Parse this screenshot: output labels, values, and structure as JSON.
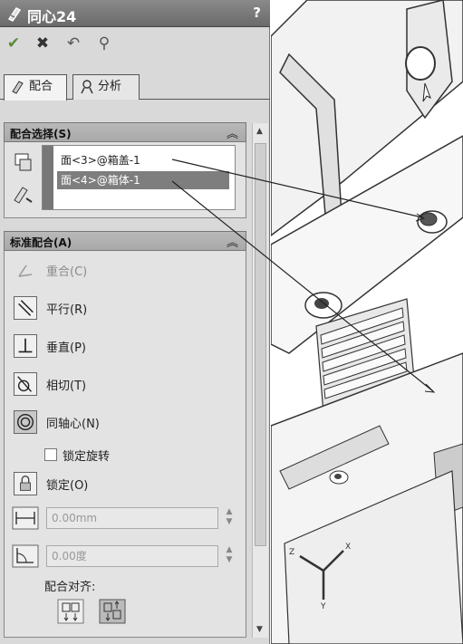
{
  "title": "同心24",
  "help": "?",
  "toolbar": {
    "ok": "✔",
    "cancel": "✖",
    "undo": "↶",
    "pin": "⚲"
  },
  "tabs": [
    {
      "label": "配合"
    },
    {
      "label": "分析"
    }
  ],
  "mate_selection": {
    "header": "配合选择(S)",
    "items": [
      "面<3>@箱盖-1",
      "面<4>@箱体-1"
    ]
  },
  "standard_mates": {
    "header": "标准配合(A)",
    "coincident": "重合(C)",
    "parallel": "平行(R)",
    "perpendicular": "垂直(P)",
    "tangent": "相切(T)",
    "concentric": "同轴心(N)",
    "lock_rotation": "锁定旋转",
    "lock": "锁定(O)",
    "distance_value": "0.00mm",
    "angle_value": "0.00度",
    "alignment_label": "配合对齐:"
  },
  "icons": [
    "mate-icon",
    "ok-icon",
    "cancel-icon",
    "undo-icon",
    "pin-icon",
    "analysis-icon",
    "collapse-icon"
  ]
}
